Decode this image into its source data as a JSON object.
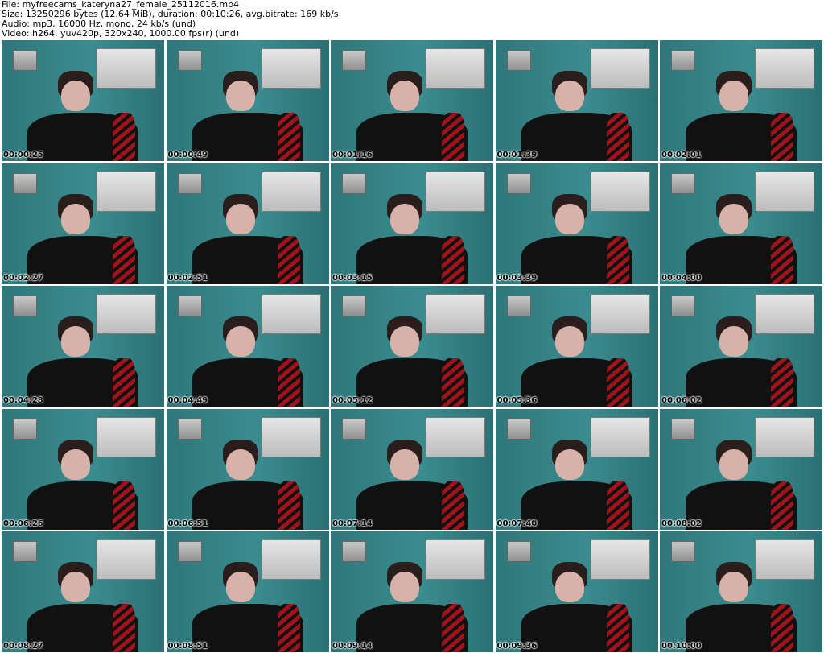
{
  "header": {
    "file": "File: myfreecams_kateryna27_female_25112016.mp4",
    "size": "Size: 13250296 bytes (12.64 MiB), duration: 00:10:26, avg.bitrate: 169 kb/s",
    "audio": "Audio: mp3, 16000 Hz, mono, 24 kb/s (und)",
    "video": "Video: h264, yuv420p, 320x240, 1000.00 fps(r) (und)"
  },
  "thumbnails": [
    "00:00:25",
    "00:00:49",
    "00:01:16",
    "00:01:39",
    "00:02:01",
    "00:02:27",
    "00:02:51",
    "00:03:15",
    "00:03:39",
    "00:04:00",
    "00:04:28",
    "00:04:49",
    "00:05:12",
    "00:05:36",
    "00:06:02",
    "00:06:26",
    "00:06:51",
    "00:07:14",
    "00:07:40",
    "00:08:02",
    "00:08:27",
    "00:08:51",
    "00:09:14",
    "00:09:36",
    "00:10:00"
  ]
}
